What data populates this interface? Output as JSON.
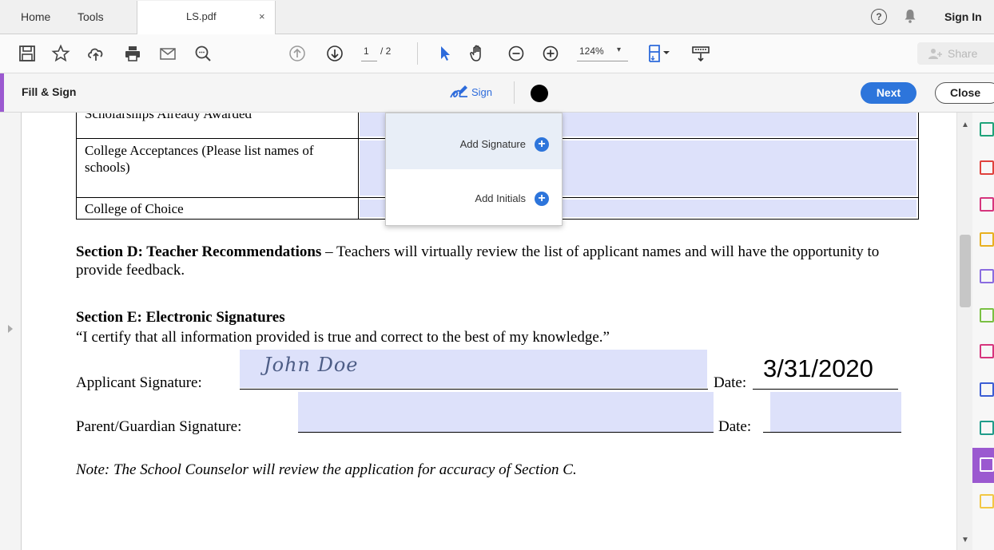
{
  "tabs": {
    "home": "Home",
    "tools": "Tools",
    "document": "LS.pdf",
    "close_glyph": "×"
  },
  "header": {
    "help_glyph": "?",
    "sign_in": "Sign In"
  },
  "toolbar": {
    "page_current": "1",
    "page_total": "/ 2",
    "zoom": "124%",
    "zoom_caret": "▾",
    "share": "Share"
  },
  "fill_sign": {
    "title": "Fill & Sign",
    "sign_label": "Sign",
    "color_swatch": "#000000",
    "next": "Next",
    "close": "Close",
    "accent": "#9b59d0",
    "primary": "#2d75db"
  },
  "sign_menu": {
    "add_signature": "Add Signature",
    "add_initials": "Add Initials",
    "plus_glyph": "+"
  },
  "table": {
    "rows": [
      {
        "label": "Scholarships Already Awarded"
      },
      {
        "label": "College Acceptances (Please list names of schools)"
      },
      {
        "label": "College of Choice"
      }
    ]
  },
  "document": {
    "section_d_title": "Section D: Teacher Recommendations",
    "section_d_text": " – Teachers will virtually review the list of applicant names and will have the opportunity to provide feedback.",
    "section_e_title": "Section E: Electronic Signatures",
    "certify": "“I certify that all information provided is true and correct to the best of my knowledge.”",
    "applicant_label": "Applicant Signature:",
    "applicant_signature": "John Doe",
    "date_label": "Date:",
    "applicant_date": "3/31/2020",
    "parent_label": "Parent/Guardian Signature:",
    "note": "Note: The School Counselor will review the application for accuracy of Section C."
  },
  "scrollbar": {
    "up_glyph": "▲",
    "down_glyph": "▼"
  },
  "rail_icons": [
    {
      "name": "export-pdf-icon",
      "color": "#1fa37a"
    },
    {
      "name": "create-pdf-icon",
      "color": "#e0413c"
    },
    {
      "name": "organize-pages-icon",
      "color": "#d6357d"
    },
    {
      "name": "comment-icon",
      "color": "#e8b020"
    },
    {
      "name": "scan-icon",
      "color": "#8a6ce0"
    },
    {
      "name": "compress-icon",
      "color": "#7ac043"
    },
    {
      "name": "edit-pdf-icon",
      "color": "#d6357d"
    },
    {
      "name": "protect-icon",
      "color": "#3c5ed4"
    },
    {
      "name": "optimize-icon",
      "color": "#1f9c8a"
    },
    {
      "name": "fill-sign-icon",
      "color": "#ffffff"
    },
    {
      "name": "more-tools-icon",
      "color": "#f2c744"
    }
  ]
}
